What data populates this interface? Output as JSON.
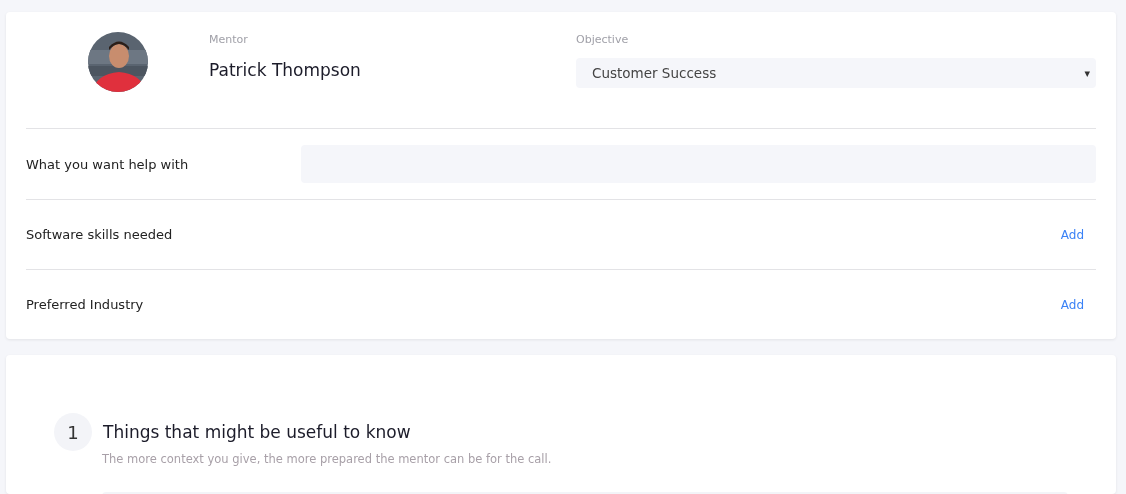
{
  "mentor": {
    "label": "Mentor",
    "name": "Patrick Thompson"
  },
  "objective": {
    "label": "Objective",
    "value": "Customer Success",
    "caret": "▾"
  },
  "rows": [
    {
      "kind": "field",
      "label": "What you want help with"
    },
    {
      "kind": "add",
      "label": "Software skills needed",
      "action": "Add"
    },
    {
      "kind": "add",
      "label": "Preferred Industry",
      "action": "Add"
    }
  ],
  "step": {
    "number": "1",
    "title": "Things that might be useful to know",
    "subtitle": "The more context you give, the more prepared the mentor can be for the call."
  }
}
